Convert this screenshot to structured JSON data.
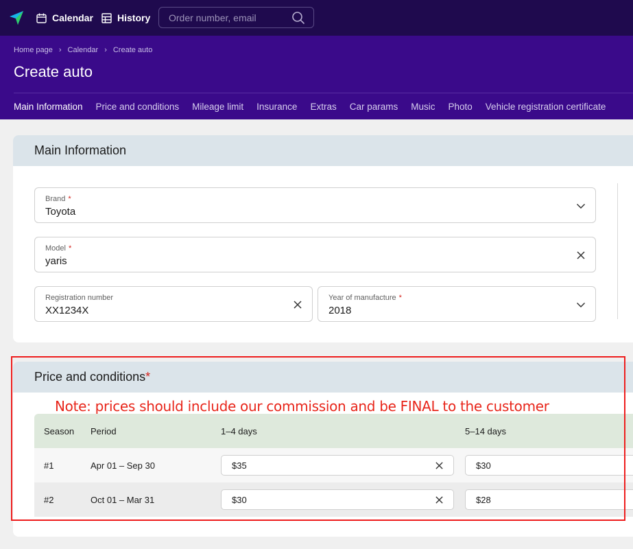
{
  "topbar": {
    "calendar_label": "Calendar",
    "history_label": "History",
    "search_placeholder": "Order number, email"
  },
  "header": {
    "breadcrumb": [
      "Home page",
      "Calendar",
      "Create auto"
    ],
    "title": "Create auto",
    "tabs": [
      {
        "label": "Main Information",
        "active": true
      },
      {
        "label": "Price and conditions",
        "active": false
      },
      {
        "label": "Mileage limit",
        "active": false
      },
      {
        "label": "Insurance",
        "active": false
      },
      {
        "label": "Extras",
        "active": false
      },
      {
        "label": "Car params",
        "active": false
      },
      {
        "label": "Music",
        "active": false
      },
      {
        "label": "Photo",
        "active": false
      },
      {
        "label": "Vehicle registration certificate",
        "active": false
      }
    ]
  },
  "main_info": {
    "title": "Main Information",
    "brand": {
      "label": "Brand",
      "required": "*",
      "value": "Toyota"
    },
    "model": {
      "label": "Model",
      "required": "*",
      "value": "yaris"
    },
    "registration": {
      "label": "Registration number",
      "value": "XX1234X"
    },
    "year": {
      "label": "Year of manufacture",
      "required": "*",
      "value": "2018"
    }
  },
  "price": {
    "title": "Price and conditions",
    "required": "*",
    "note": "Note: prices should include our commission and be FINAL to the customer",
    "columns": [
      "Season",
      "Period",
      "1–4 days",
      "5–14 days"
    ],
    "rows": [
      {
        "season": "#1",
        "period": "Apr 01 – Sep 30",
        "p1": "$35",
        "p2": "$30"
      },
      {
        "season": "#2",
        "period": "Oct 01 – Mar 31",
        "p1": "$30",
        "p2": "$28"
      }
    ]
  },
  "colors": {
    "topbar": "#1f0a4e",
    "header": "#3a0a8a",
    "section_head": "#dbe4ea",
    "table_head": "#dee9dc",
    "required": "#d4231c",
    "annotation": "#ee1c1c"
  }
}
